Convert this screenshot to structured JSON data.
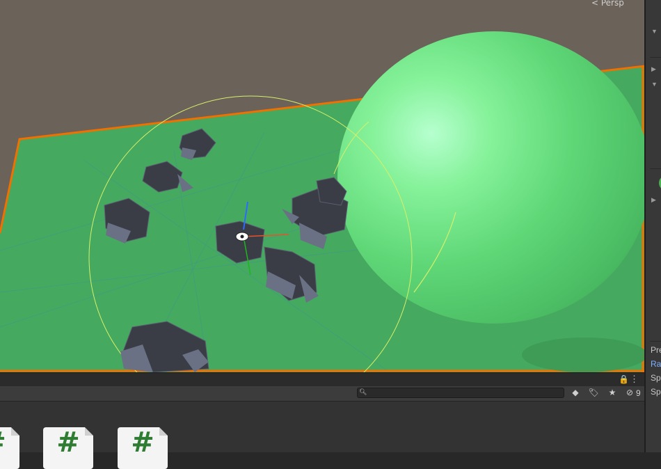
{
  "scene_view": {
    "camera_mode_label": "< Persp",
    "colors": {
      "background": "#6b6259",
      "ground": "#4caf67",
      "selection_outline": "#f07000",
      "sphere": "#6ee38a",
      "gizmo_circle": "#d7f06a",
      "rocks": "#3b3f48"
    }
  },
  "inspector": {
    "items": [
      {
        "label": "Pre"
      },
      {
        "label": "Rad",
        "selected": true
      },
      {
        "label": "Spa"
      },
      {
        "label": "Spa"
      }
    ]
  },
  "project_panel": {
    "search": {
      "placeholder": "",
      "value": ""
    },
    "toolbar_icons": [
      "filter-by-type-icon",
      "filter-by-label-icon",
      "favorites-icon",
      "hidden-packages-icon"
    ],
    "hidden_count": "9",
    "lock_icon": "🔒",
    "menu_icon": "⋮",
    "assets": [
      {
        "type": "script",
        "glyph": "#"
      },
      {
        "type": "script",
        "glyph": "#"
      },
      {
        "type": "script",
        "glyph": "#"
      }
    ]
  }
}
